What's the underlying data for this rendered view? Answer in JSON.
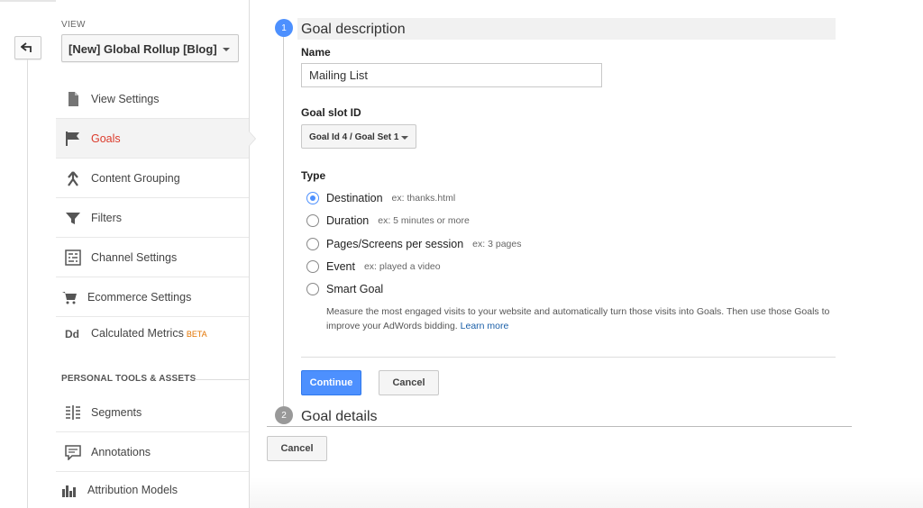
{
  "view": {
    "label": "VIEW",
    "selected": "[New] Global Rollup [Blog]"
  },
  "sidebar": {
    "items": [
      {
        "label": "View Settings",
        "icon": "document-icon"
      },
      {
        "label": "Goals",
        "icon": "flag-icon",
        "active": true
      },
      {
        "label": "Content Grouping",
        "icon": "content-grouping-icon"
      },
      {
        "label": "Filters",
        "icon": "funnel-icon"
      },
      {
        "label": "Channel Settings",
        "icon": "channel-settings-icon"
      },
      {
        "label": "Ecommerce Settings",
        "icon": "cart-icon"
      },
      {
        "label": "Calculated Metrics",
        "badge": "BETA",
        "icon": "dd-icon"
      }
    ],
    "section_heading": "PERSONAL TOOLS & ASSETS",
    "tools": [
      {
        "label": "Segments",
        "icon": "segments-icon"
      },
      {
        "label": "Annotations",
        "icon": "annotation-icon"
      },
      {
        "label": "Attribution Models",
        "icon": "bar-chart-icon"
      }
    ]
  },
  "goal": {
    "step1": {
      "number": "1",
      "title": "Goal description"
    },
    "name_label": "Name",
    "name_value": "Mailing List",
    "slot_label": "Goal slot ID",
    "slot_value": "Goal Id 4 / Goal Set 1",
    "type_label": "Type",
    "types": [
      {
        "label": "Destination",
        "example": "ex: thanks.html",
        "checked": true
      },
      {
        "label": "Duration",
        "example": "ex: 5 minutes or more"
      },
      {
        "label": "Pages/Screens per session",
        "example": "ex: 3 pages"
      },
      {
        "label": "Event",
        "example": "ex: played a video"
      },
      {
        "label": "Smart Goal",
        "example": ""
      }
    ],
    "smart_description": "Measure the most engaged visits to your website and automatically turn those visits into Goals. Then use those Goals to improve your AdWords bidding.",
    "learn_more": "Learn more",
    "continue_label": "Continue",
    "cancel_label": "Cancel",
    "step2": {
      "number": "2",
      "title": "Goal details"
    },
    "bottom_cancel_label": "Cancel"
  },
  "colors": {
    "accent": "#4d90fe",
    "active_nav": "#dc3b2c",
    "beta": "#e37400",
    "link": "#1a5fa8"
  }
}
